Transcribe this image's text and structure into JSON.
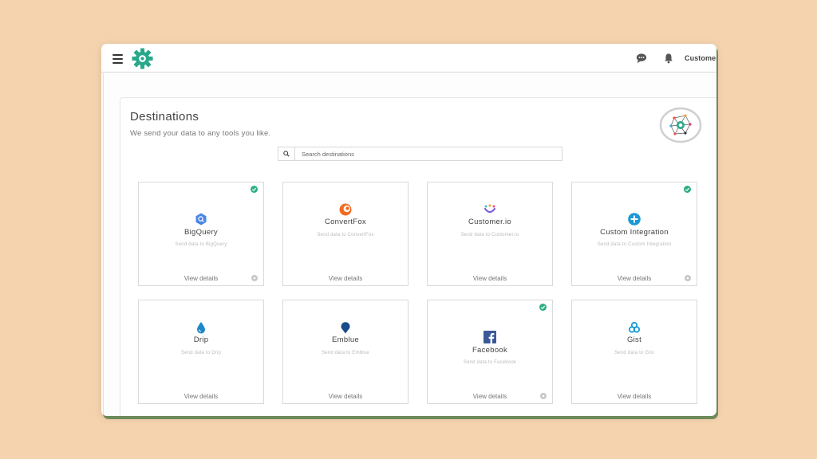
{
  "topbar": {
    "user_name": "CustomerLabs"
  },
  "page": {
    "title": "Destinations",
    "subtitle": "We send your data to any tools you like."
  },
  "search": {
    "placeholder": "Search destinations"
  },
  "colors": {
    "brand": "#2aa88a",
    "check": "#2eaf82",
    "card_border": "#dadada",
    "background": "#f5d3ae"
  },
  "cards": [
    {
      "name": "BigQuery",
      "description": "Send data to BigQuery",
      "link": "View details",
      "icon": "bigquery-icon",
      "enabled": true
    },
    {
      "name": "ConvertFox",
      "description": "Send data to ConvertFox",
      "link": "View details",
      "icon": "convertfox-icon",
      "enabled": false
    },
    {
      "name": "Customer.io",
      "description": "Send data to Customer.io",
      "link": "View details",
      "icon": "customerio-icon",
      "enabled": false
    },
    {
      "name": "Custom Integration",
      "description": "Send data to Custom Integration",
      "link": "View details",
      "icon": "plus-circle-icon",
      "enabled": true
    },
    {
      "name": "Drip",
      "description": "Send data to Drip",
      "link": "View details",
      "icon": "drip-icon",
      "enabled": false
    },
    {
      "name": "Emblue",
      "description": "Send data to Emblue",
      "link": "View details",
      "icon": "emblue-icon",
      "enabled": false
    },
    {
      "name": "Facebook",
      "description": "Send data to Facebook",
      "link": "View details",
      "icon": "facebook-icon",
      "enabled": true
    },
    {
      "name": "Gist",
      "description": "Send data to Gist",
      "link": "View details",
      "icon": "gist-icon",
      "enabled": false
    }
  ]
}
